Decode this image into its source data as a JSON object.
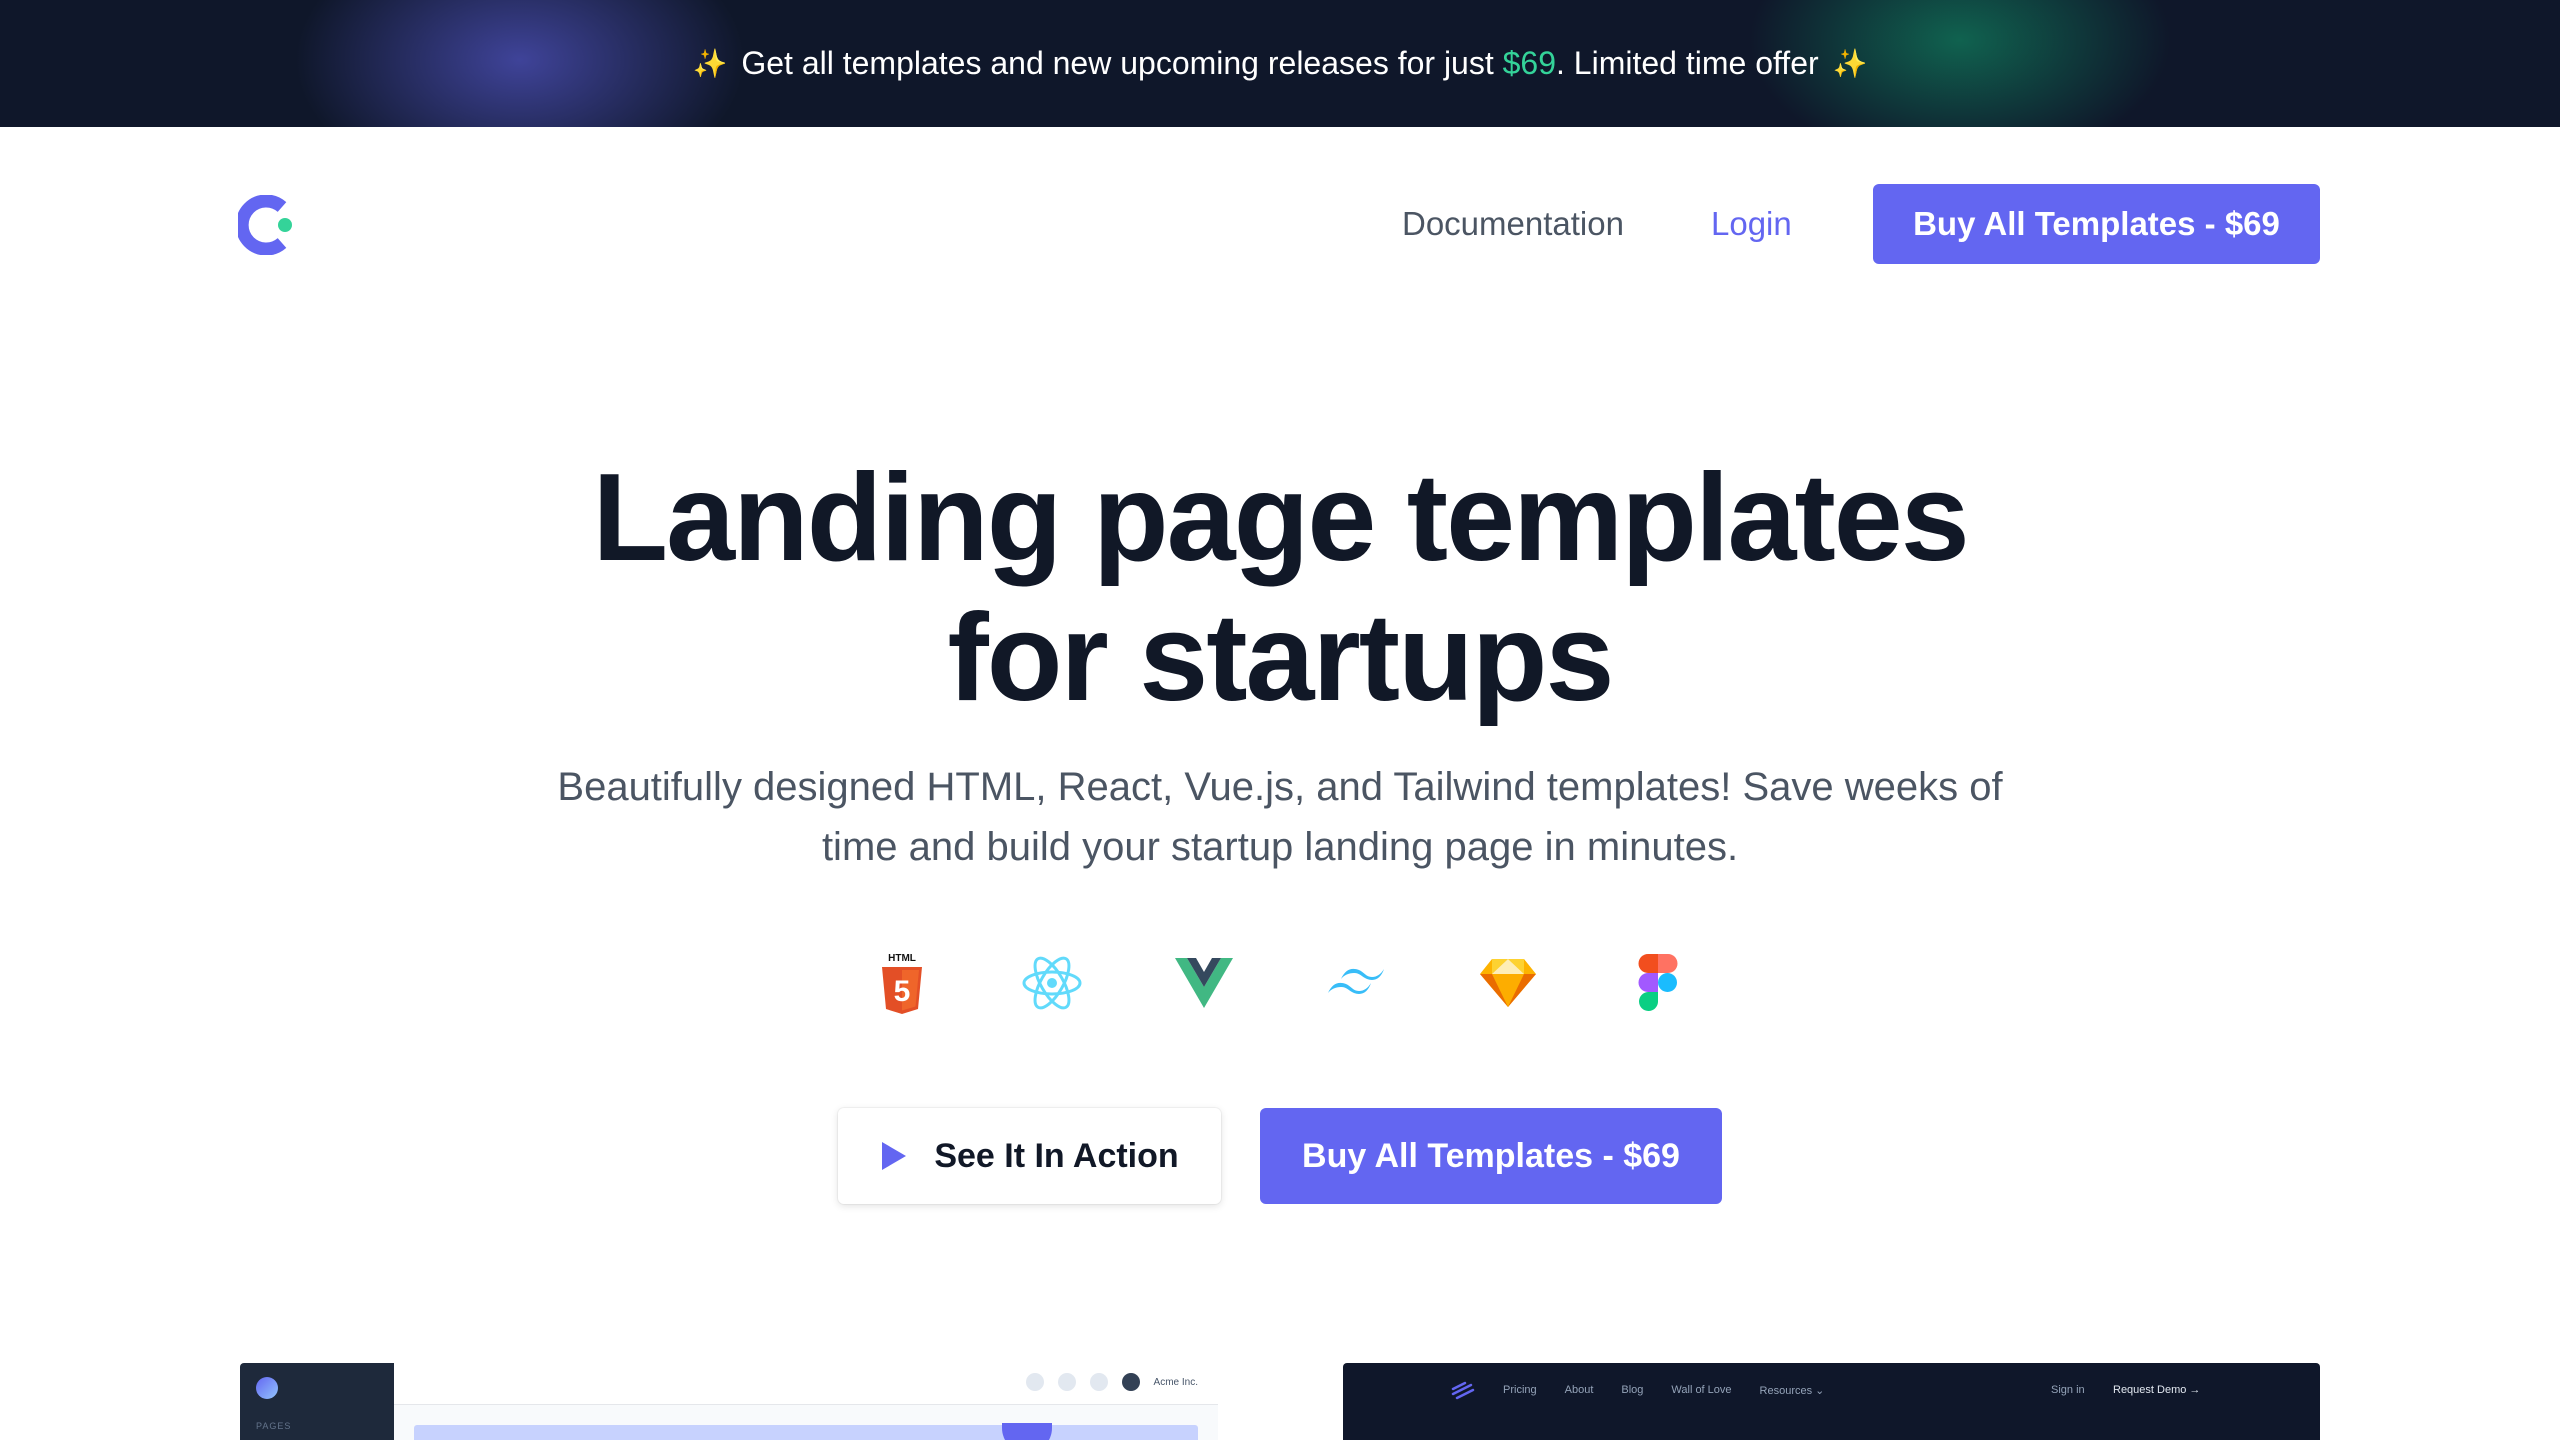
{
  "promo": {
    "sparkle_left": "✨",
    "text_before": "Get all templates and new upcoming releases for just ",
    "price": "$69",
    "text_after": ". Limited time offer",
    "sparkle_right": "✨",
    "colors": {
      "background": "#0f172a",
      "price": "#34d399"
    }
  },
  "header": {
    "logo_icon": "cruip-logo-icon",
    "nav": {
      "documentation": "Documentation",
      "login": "Login"
    },
    "cta": "Buy All Templates - $69"
  },
  "hero": {
    "title_line1": "Landing page templates",
    "title_line2": "for startups",
    "subtitle_line1": "Beautifully designed HTML, React, Vue.js, and Tailwind templates! Save weeks of",
    "subtitle_line2": "time and build your startup landing page in minutes.",
    "techs": [
      {
        "name": "HTML",
        "icon": "html5-icon"
      },
      {
        "name": "React",
        "icon": "react-icon"
      },
      {
        "name": "Vue.js",
        "icon": "vue-icon"
      },
      {
        "name": "Tailwind",
        "icon": "tailwind-icon"
      },
      {
        "name": "Sketch",
        "icon": "sketch-icon"
      },
      {
        "name": "Figma",
        "icon": "figma-icon"
      }
    ],
    "html5_label": "HTML",
    "secondary_button": "See It In Action",
    "primary_button": "Buy All Templates - $69",
    "accent_color": "#6366f1"
  },
  "previews": {
    "left": {
      "sidebar_label": "PAGES",
      "account": "Acme Inc."
    },
    "right": {
      "nav": [
        "Pricing",
        "About",
        "Blog",
        "Wall of Love",
        "Resources ⌄"
      ],
      "sign_in": "Sign in",
      "cta": "Request Demo →"
    }
  }
}
